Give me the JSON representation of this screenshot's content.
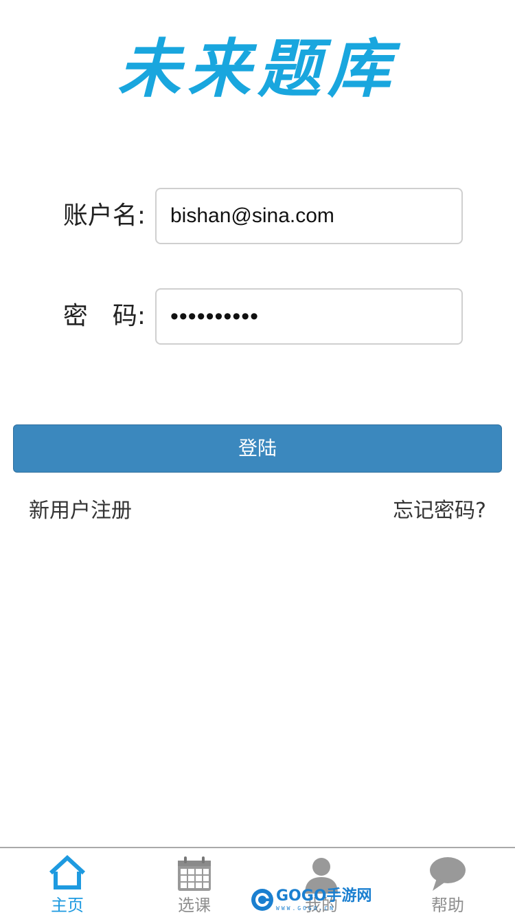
{
  "app": {
    "logo_text": "未来题库"
  },
  "login_form": {
    "username_label": "账户名:",
    "username_value": "bishan@sina.com",
    "password_label": "密　码:",
    "password_value": "••••••••••",
    "login_button": "登陆",
    "register_link": "新用户注册",
    "forgot_link": "忘记密码?"
  },
  "tabbar": {
    "items": [
      {
        "label": "主页",
        "icon": "home-icon",
        "active": true
      },
      {
        "label": "选课",
        "icon": "calendar-icon",
        "active": false
      },
      {
        "label": "我的",
        "icon": "person-icon",
        "active": false
      },
      {
        "label": "帮助",
        "icon": "chat-bubble-icon",
        "active": false
      }
    ]
  },
  "watermark": {
    "text": "GOGO手游网",
    "sub": "WWW.GOGO.CN"
  },
  "colors": {
    "accent": "#19a6de",
    "button": "#3b88be",
    "active_tab": "#1e9ae0",
    "inactive_tab": "#8f8f8f"
  }
}
